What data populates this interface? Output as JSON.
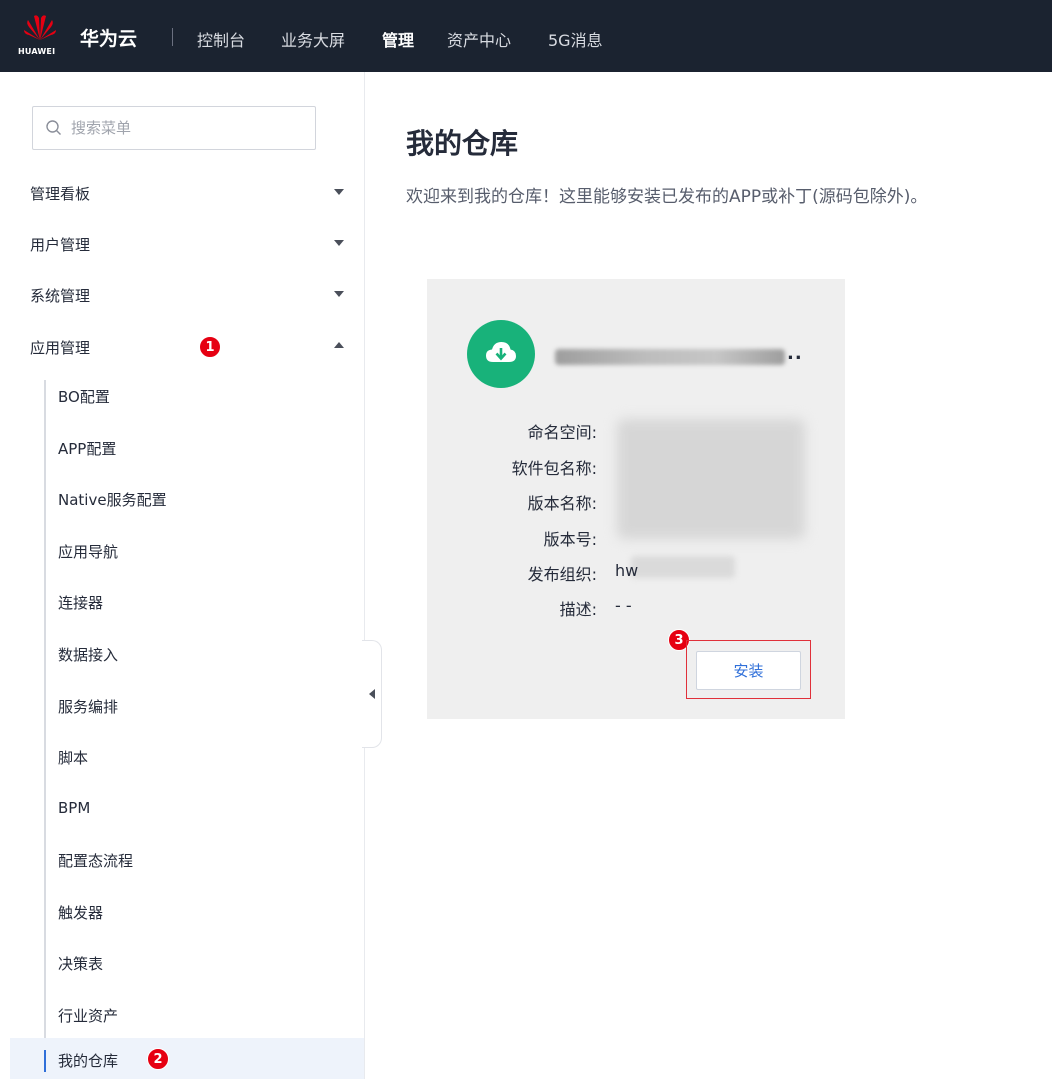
{
  "header": {
    "logo_text": "HUAWEI",
    "brand": "华为云",
    "nav": [
      "控制台",
      "业务大屏",
      "管理",
      "资产中心",
      "5G消息"
    ],
    "active_nav": "管理",
    "brand_color": "#e60012"
  },
  "sidebar": {
    "search_placeholder": "搜索菜单",
    "groups": [
      {
        "label": "管理看板",
        "expanded": false
      },
      {
        "label": "用户管理",
        "expanded": false
      },
      {
        "label": "系统管理",
        "expanded": false
      },
      {
        "label": "应用管理",
        "expanded": true
      }
    ],
    "app_management_items": [
      "BO配置",
      "APP配置",
      "Native服务配置",
      "应用导航",
      "连接器",
      "数据接入",
      "服务编排",
      "脚本",
      "BPM",
      "配置态流程",
      "触发器",
      "决策表",
      "行业资产",
      "我的仓库"
    ],
    "selected_item": "我的仓库"
  },
  "badges": {
    "one": "1",
    "two": "2",
    "three": "3"
  },
  "main": {
    "title": "我的仓库",
    "description": "欢迎来到我的仓库！这里能够安装已发布的APP或补丁(源码包除外)。"
  },
  "card": {
    "app_name_suffix": "..",
    "fields": [
      {
        "label": "命名空间:",
        "value": ""
      },
      {
        "label": "软件包名称:",
        "value": ""
      },
      {
        "label": "版本名称:",
        "value": ""
      },
      {
        "label": "版本号:",
        "value": ""
      },
      {
        "label": "发布组织:",
        "value": "hw"
      },
      {
        "label": "描述:",
        "value": "- -"
      }
    ],
    "install_label": "安装",
    "icon": "cloud-download-icon",
    "icon_color": "#18b27a"
  }
}
